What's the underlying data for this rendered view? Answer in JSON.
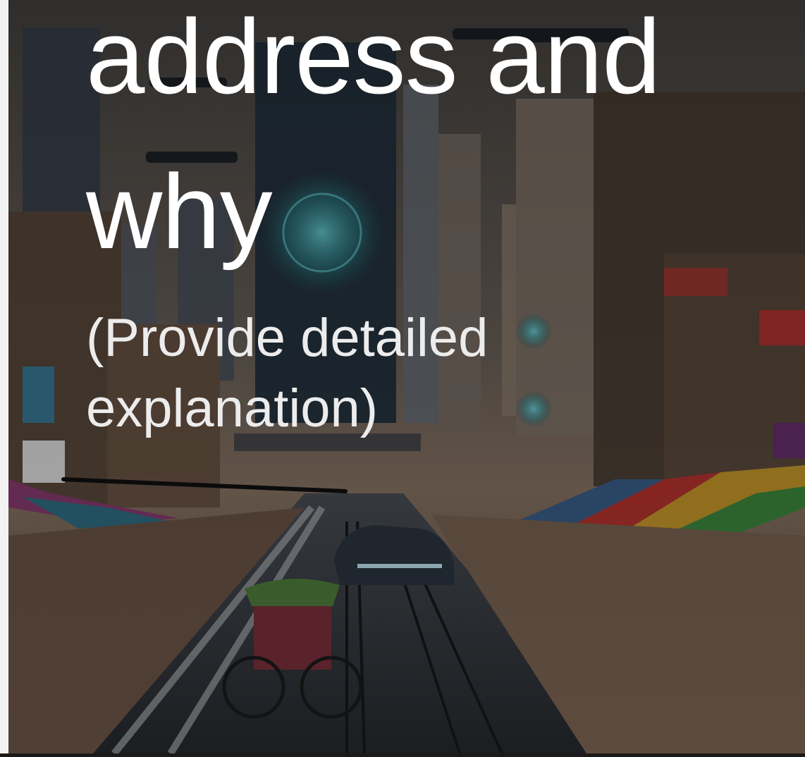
{
  "slide": {
    "title": "address and why",
    "subtitle": "(Provide detailed explanation)"
  },
  "background": {
    "description_icon": "futuristic-city-street-image",
    "palette": {
      "sky": "#5b5550",
      "road": "#2b2e33",
      "awning_red": "#b8342f",
      "awning_green": "#3d8a3e",
      "hologram": "#3fb8c0"
    }
  }
}
